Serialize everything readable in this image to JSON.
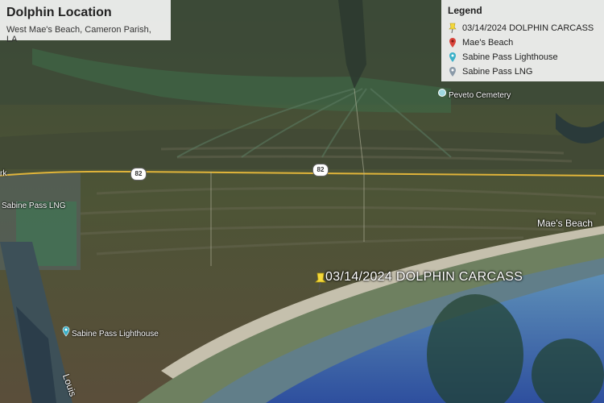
{
  "map": {
    "title": "Dolphin Location",
    "subtitle": "West Mae's Beach, Cameron Parish, LA"
  },
  "legend": {
    "title": "Legend",
    "items": [
      {
        "label": "03/14/2024 DOLPHIN CARCASS",
        "icon": "yellow-pushpin-icon",
        "color": "#f4d83a"
      },
      {
        "label": "Mae's Beach",
        "icon": "red-pin-icon",
        "color": "#d9443a"
      },
      {
        "label": "Sabine Pass Lighthouse",
        "icon": "teal-pin-icon",
        "color": "#3ab0c8"
      },
      {
        "label": "Sabine Pass LNG",
        "icon": "gray-pin-icon",
        "color": "#8a9aa8"
      }
    ]
  },
  "places": {
    "peveto": "Peveto Cemetery",
    "maes_beach": "Mae's Beach",
    "sabine_lng": "Sabine Pass LNG",
    "lighthouse": "Sabine Pass Lighthouse",
    "carcass": "03/14/2024 DOLPHIN CARCASS",
    "edge_left": "rk",
    "louisiana": "Louis"
  },
  "highway": {
    "number": "82",
    "color": "#e0b43a"
  }
}
